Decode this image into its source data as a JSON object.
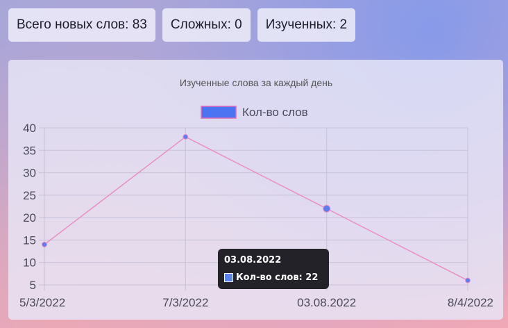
{
  "stats": {
    "total_label": "Всего новых слов: 83",
    "hard_label": "Сложных: 0",
    "learned_label": "Изученных: 2"
  },
  "colors": {
    "line": "#e890c6",
    "point": "#5b7df0",
    "legend_fill": "#4c74f2",
    "legend_border": "#e06ab8",
    "grid": "#c7c2d8",
    "text": "#4a4a5a"
  },
  "chart_data": {
    "type": "line",
    "title": "Изученные слова за каждый день",
    "categories": [
      "5/3/2022",
      "7/3/2022",
      "03.08.2022",
      "8/4/2022"
    ],
    "series": [
      {
        "name": "Кол-во слов",
        "values": [
          14,
          38,
          22,
          6
        ]
      }
    ],
    "ylim": [
      5,
      40
    ],
    "yticks": [
      40,
      35,
      30,
      25,
      20,
      15,
      10,
      5
    ],
    "grid": true,
    "legend": "top-center"
  },
  "tooltip": {
    "title": "03.08.2022",
    "series": "Кол-во слов",
    "value": "22"
  }
}
